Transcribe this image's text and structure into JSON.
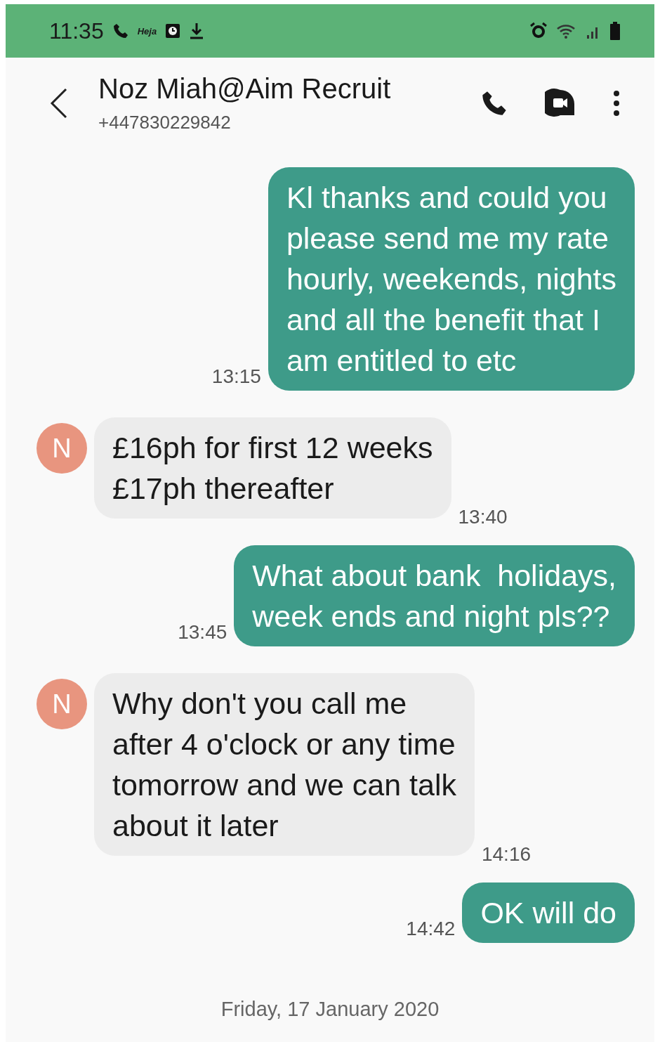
{
  "status_bar": {
    "time": "11:35",
    "carrier_label": "Heja"
  },
  "header": {
    "contact_name": "Noz Miah@Aim Recruit",
    "phone_number": "+447830229842"
  },
  "messages": [
    {
      "kind": "sent",
      "text": "Kl thanks and could you\nplease send me my rate\nhourly, weekends, nights\nand all the benefit that I\nam entitled to etc",
      "time": "13:15"
    },
    {
      "kind": "received",
      "avatar": "N",
      "color": "#e8957f",
      "text": "£16ph for first 12 weeks\n£17ph thereafter",
      "time": "13:40"
    },
    {
      "kind": "sent",
      "text": "What about bank  holidays,\nweek ends and night pls??",
      "time": "13:45"
    },
    {
      "kind": "received",
      "avatar": "N",
      "color": "#e8957f",
      "text": "Why don't you call me\nafter 4 o'clock or any time\ntomorrow and we can talk\nabout it later",
      "time": "14:16"
    },
    {
      "kind": "sent",
      "text": "OK will do",
      "time": "14:42"
    }
  ],
  "date_divider": "Friday, 17 January 2020"
}
